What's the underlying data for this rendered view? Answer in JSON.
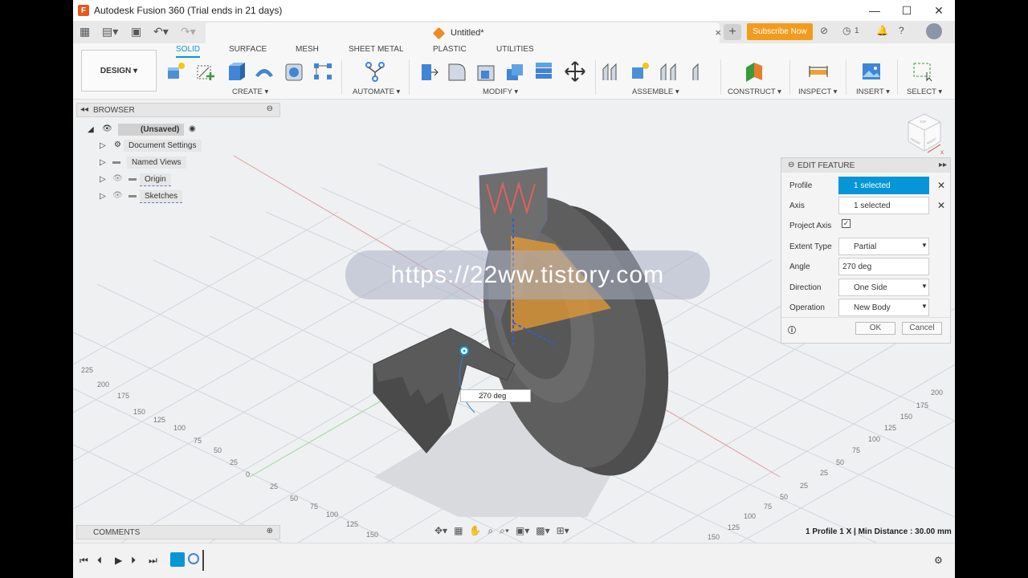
{
  "title_bar": {
    "app_title": "Autodesk Fusion 360 (Trial ends in 21 days)",
    "minimize": "—",
    "maximize": "☐",
    "close": "✕"
  },
  "tabs_row": {
    "doc_title": "Untitled*",
    "close": "×",
    "new_tab": "+",
    "subscribe": "Subscribe Now",
    "jobs_count": "1"
  },
  "workspace": {
    "design_label": "DESIGN ▾"
  },
  "toolbar_tabs": [
    "SOLID",
    "SURFACE",
    "MESH",
    "SHEET METAL",
    "PLASTIC",
    "UTILITIES"
  ],
  "toolbar_groups": {
    "create": "CREATE ▾",
    "automate": "AUTOMATE ▾",
    "modify": "MODIFY ▾",
    "assemble": "ASSEMBLE ▾",
    "construct": "CONSTRUCT ▾",
    "inspect": "INSPECT ▾",
    "insert": "INSERT ▾",
    "select": "SELECT ▾"
  },
  "browser": {
    "header": "BROWSER",
    "root": "(Unsaved)",
    "items": [
      "Document Settings",
      "Named Views",
      "Origin",
      "Sketches"
    ]
  },
  "edit_feature": {
    "header": "EDIT FEATURE",
    "profile_label": "Profile",
    "profile_value": "1 selected",
    "axis_label": "Axis",
    "axis_value": "1 selected",
    "project_axis_label": "Project Axis",
    "extent_type_label": "Extent Type",
    "extent_type_value": "Partial",
    "angle_label": "Angle",
    "angle_value": "270 deg",
    "direction_label": "Direction",
    "direction_value": "One Side",
    "operation_label": "Operation",
    "operation_value": "New Body",
    "ok": "OK",
    "cancel": "Cancel"
  },
  "viewport": {
    "angle_input": "270 deg",
    "watermark": "https://22ww.tistory.com",
    "status": "1 Profile 1 X | Min Distance : 30.00 mm",
    "viewcube_faces": [
      "FRONT",
      "RIGHT",
      "TOP"
    ]
  },
  "comments": {
    "header": "COMMENTS"
  },
  "colors": {
    "accent": "#0696d7",
    "subscribe": "#f29c1e",
    "body": "#5e5e5e"
  }
}
